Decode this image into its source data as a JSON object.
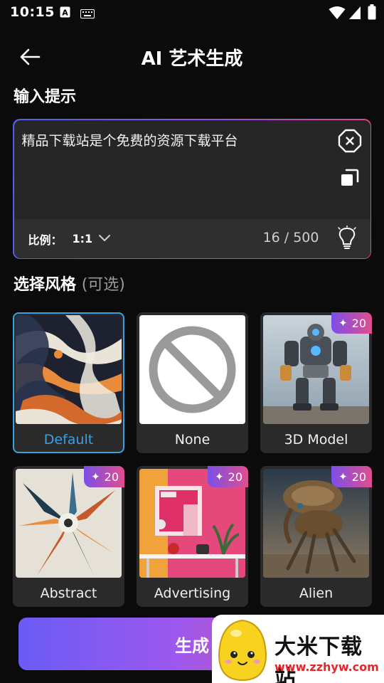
{
  "status_bar": {
    "time": "10:15"
  },
  "header": {
    "title": "AI 艺术生成"
  },
  "prompt": {
    "section_label": "输入提示",
    "text": "精品下载站是个免费的资源下载平台",
    "ratio_label": "比例：",
    "ratio_value": "1:1",
    "counter": "16 / 500"
  },
  "styles": {
    "section_label": "选择风格",
    "optional_label": "(可选)",
    "items": [
      {
        "label": "Default",
        "badge": ""
      },
      {
        "label": "None",
        "badge": ""
      },
      {
        "label": "3D Model",
        "badge": "20"
      },
      {
        "label": "Abstract",
        "badge": "20"
      },
      {
        "label": "Advertising",
        "badge": "20"
      },
      {
        "label": "Alien",
        "badge": "20"
      }
    ]
  },
  "generate_button": {
    "label": "生成"
  },
  "watermark": {
    "title": "大米下载站",
    "url": "www.zzhyw.com"
  },
  "colors": {
    "accent_blue": "#3aa0e0",
    "gradient_start": "#6a5bf4",
    "gradient_end": "#e0528e"
  }
}
